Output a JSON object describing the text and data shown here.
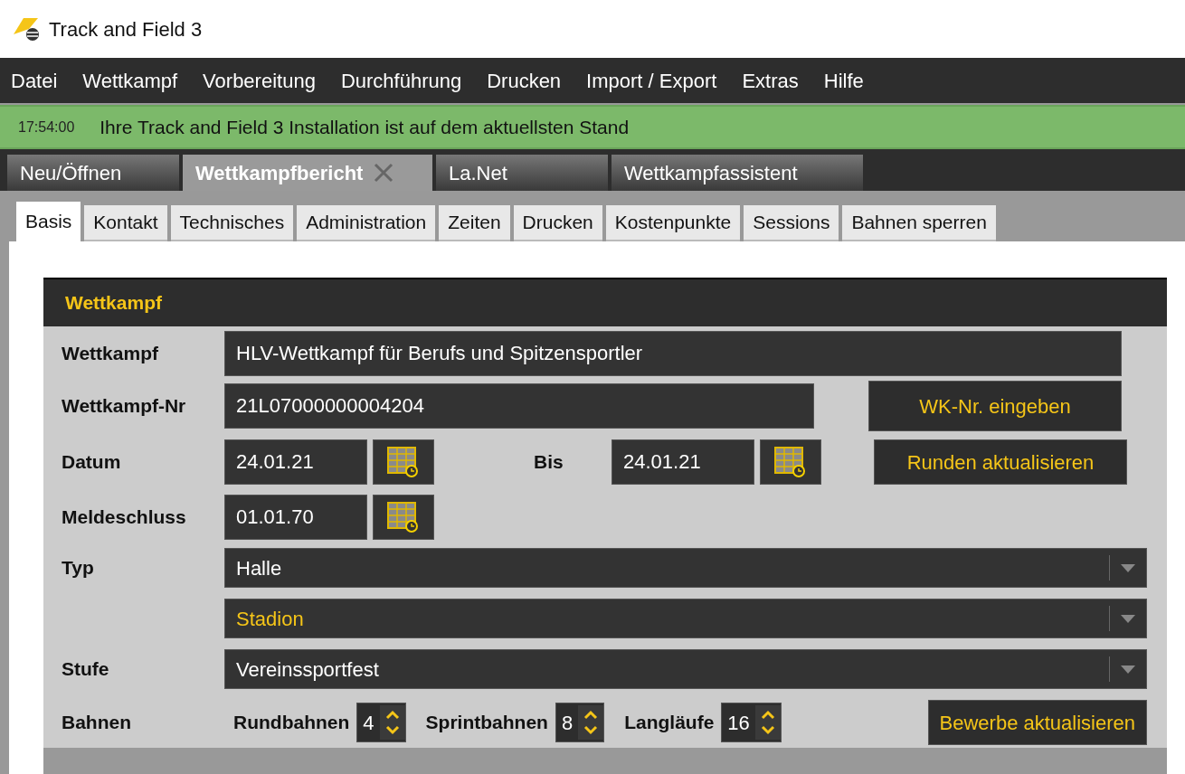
{
  "window": {
    "title": "Track and Field 3"
  },
  "menu": [
    "Datei",
    "Wettkampf",
    "Vorbereitung",
    "Durchführung",
    "Drucken",
    "Import / Export",
    "Extras",
    "Hilfe"
  ],
  "status": {
    "time": "17:54:00",
    "message": "Ihre Track and Field 3 Installation ist auf dem aktuellsten Stand"
  },
  "doc_tabs": [
    {
      "label": "Neu/Öffnen",
      "selected": false,
      "closable": false
    },
    {
      "label": "Wettkampfbericht",
      "selected": true,
      "closable": true
    },
    {
      "label": "La.Net",
      "selected": false,
      "closable": false
    },
    {
      "label": "Wettkampfassistent",
      "selected": false,
      "closable": false
    }
  ],
  "sub_tabs": [
    {
      "label": "Basis",
      "selected": true
    },
    {
      "label": "Kontakt",
      "selected": false
    },
    {
      "label": "Technisches",
      "selected": false
    },
    {
      "label": "Administration",
      "selected": false
    },
    {
      "label": "Zeiten",
      "selected": false
    },
    {
      "label": "Drucken",
      "selected": false
    },
    {
      "label": "Kostenpunkte",
      "selected": false
    },
    {
      "label": "Sessions",
      "selected": false
    },
    {
      "label": "Bahnen sperren",
      "selected": false
    }
  ],
  "section": {
    "title": "Wettkampf",
    "wettkampf": {
      "label": "Wettkampf",
      "value": "HLV-Wettkampf für Berufs und Spitzensportler"
    },
    "nr": {
      "label": "Wettkampf-Nr",
      "value": "21L07000000004204",
      "button": "WK-Nr. eingeben"
    },
    "datum": {
      "label": "Datum",
      "value": "24.01.21",
      "bis_label": "Bis",
      "bis_value": "24.01.21",
      "button": "Runden aktualisieren"
    },
    "meldeschluss": {
      "label": "Meldeschluss",
      "value": "01.01.70"
    },
    "typ": {
      "label": "Typ",
      "combos": [
        {
          "value": "Halle",
          "highlighted": false
        },
        {
          "value": "Stadion",
          "highlighted": true
        }
      ]
    },
    "stufe": {
      "label": "Stufe",
      "value": "Vereinssportfest"
    },
    "bahnen": {
      "label": "Bahnen",
      "spinners": [
        {
          "label": "Rundbahnen",
          "value": "4"
        },
        {
          "label": "Sprintbahnen",
          "value": "8"
        },
        {
          "label": "Langläufe",
          "value": "16"
        }
      ],
      "button": "Bewerbe aktualisieren"
    }
  }
}
